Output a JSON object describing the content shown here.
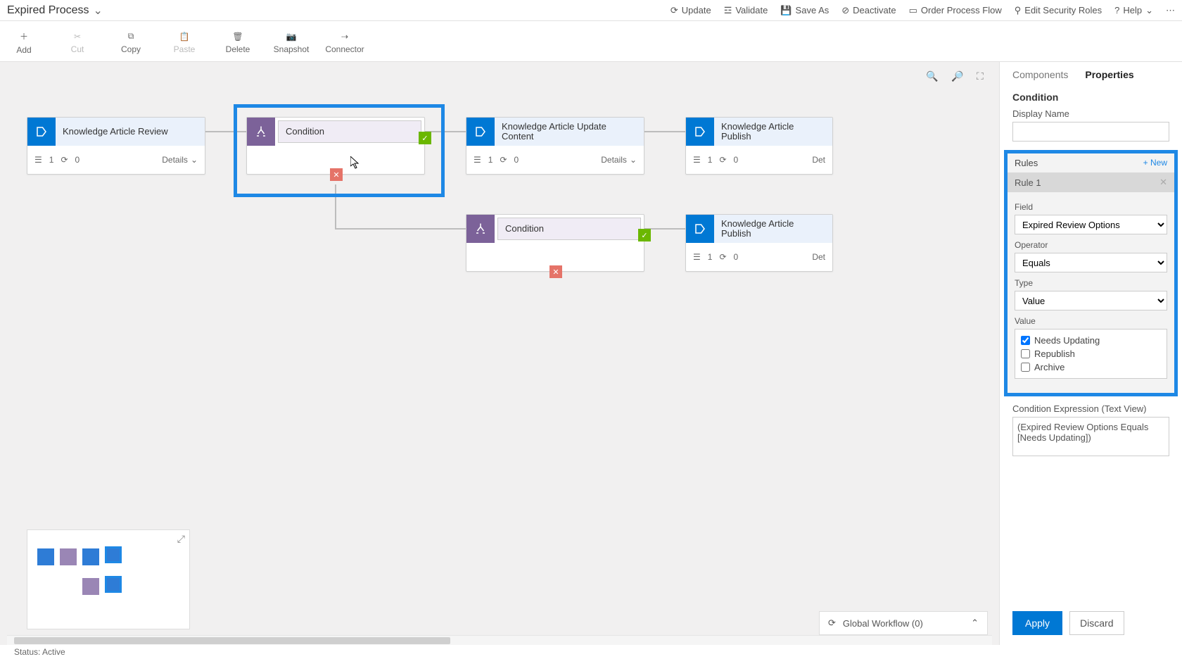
{
  "header": {
    "title": "Expired Process"
  },
  "topbuttons": {
    "update": "Update",
    "validate": "Validate",
    "save_as": "Save As",
    "deactivate": "Deactivate",
    "order": "Order Process Flow",
    "security": "Edit Security Roles",
    "help": "Help"
  },
  "ribbon": {
    "add": "Add",
    "cut": "Cut",
    "copy": "Copy",
    "paste": "Paste",
    "delete": "Delete",
    "snapshot": "Snapshot",
    "connector": "Connector"
  },
  "nodes": {
    "n1": {
      "title": "Knowledge Article Review",
      "steps": "1",
      "count": "0",
      "details": "Details"
    },
    "n2": {
      "title": "Condition"
    },
    "n3": {
      "title": "Knowledge Article Update Content",
      "steps": "1",
      "count": "0",
      "details": "Details"
    },
    "n4": {
      "title": "Knowledge Article Publish",
      "steps": "1",
      "count": "0",
      "details": "Det"
    },
    "n5": {
      "title": "Condition"
    },
    "n6": {
      "title": "Knowledge Article Publish",
      "steps": "1",
      "count": "0",
      "details": "Det"
    }
  },
  "global_workflow": "Global Workflow (0)",
  "panel": {
    "tabs": {
      "components": "Components",
      "properties": "Properties"
    },
    "section": "Condition",
    "display_name_label": "Display Name",
    "display_name_value": "",
    "rules_label": "Rules",
    "new_label": "+ New",
    "rule_title": "Rule 1",
    "field_label": "Field",
    "field_value": "Expired Review Options",
    "operator_label": "Operator",
    "operator_value": "Equals",
    "type_label": "Type",
    "type_value": "Value",
    "value_label": "Value",
    "opts": {
      "a": "Needs Updating",
      "b": "Republish",
      "c": "Archive"
    },
    "expr_label": "Condition Expression (Text View)",
    "expr_value": "(Expired Review Options Equals [Needs Updating])",
    "apply": "Apply",
    "discard": "Discard"
  },
  "status": "Status: Active"
}
